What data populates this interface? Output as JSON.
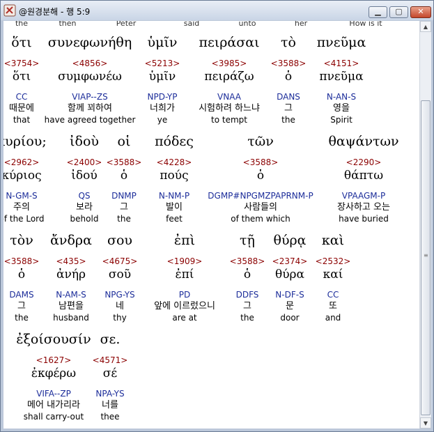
{
  "window": {
    "title": "@원경분해 - 행 5:9",
    "min_label": "▁",
    "max_label": "▢",
    "close_label": "✕"
  },
  "top_glosses": [
    "the",
    "then",
    "Peter",
    "said",
    "unto",
    "her",
    "How is it"
  ],
  "rows": [
    [
      {
        "greek": "ὅτι",
        "strong": "<3754>",
        "lemma": "ὅτι",
        "parse": "CC",
        "korean": "때문에",
        "english": "that"
      },
      {
        "greek": "συνεφωνήθη",
        "strong": "<4856>",
        "lemma": "συμφωνέω",
        "parse": "VIAP--ZS",
        "korean": "함께 꾀하여",
        "english": "have agreed together"
      },
      {
        "greek": "ὑμῖν",
        "strong": "<5213>",
        "lemma": "ὑμῖν",
        "parse": "NPD-YP",
        "korean": "너희가",
        "english": "ye"
      },
      {
        "greek": "πειράσαι",
        "strong": "<3985>",
        "lemma": "πειράζω",
        "parse": "VNAA",
        "korean": "시험하려 하느냐",
        "english": "to tempt"
      },
      {
        "greek": "τὸ",
        "strong": "<3588>",
        "lemma": "ὁ",
        "parse": "DANS",
        "korean": "그",
        "english": "the"
      },
      {
        "greek": "πνεῦμα",
        "strong": "<4151>",
        "lemma": "πνεῦμα",
        "parse": "N-AN-S",
        "korean": "영을",
        "english": "Spirit"
      }
    ],
    [
      {
        "greek": "κυρίου;",
        "strong": "<2962>",
        "lemma": "κύριος",
        "parse": "N-GM-S",
        "korean": "주의",
        "english": "of the Lord"
      },
      {
        "greek": "ἰδοὺ",
        "strong": "<2400>",
        "lemma": "ἰδού",
        "parse": "QS",
        "korean": "보라",
        "english": "behold"
      },
      {
        "greek": "οἱ",
        "strong": "<3588>",
        "lemma": "ὁ",
        "parse": "DNMP",
        "korean": "그",
        "english": "the"
      },
      {
        "greek": "πόδες",
        "strong": "<4228>",
        "lemma": "πούς",
        "parse": "N-NM-P",
        "korean": "발이",
        "english": "feet"
      },
      {
        "greek": "τῶν",
        "strong": "<3588>",
        "lemma": "ὁ",
        "parse": "DGMP#NPGMZPAPRNM-P",
        "korean": "사람들의",
        "english": "of them which"
      },
      {
        "greek": "θαψάντων",
        "strong": "<2290>",
        "lemma": "θάπτω",
        "parse": "VPAAGM-P",
        "korean": "장사하고 오는",
        "english": "have buried"
      }
    ],
    [
      {
        "greek": "τὸν",
        "strong": "<3588>",
        "lemma": "ὁ",
        "parse": "DAMS",
        "korean": "그",
        "english": "the"
      },
      {
        "greek": "ἄνδρα",
        "strong": "<435>",
        "lemma": "ἀνήρ",
        "parse": "N-AM-S",
        "korean": "남편을",
        "english": "husband"
      },
      {
        "greek": "σου",
        "strong": "<4675>",
        "lemma": "σοῦ",
        "parse": "NPG-YS",
        "korean": "네",
        "english": "thy"
      },
      {
        "greek": "ἐπὶ",
        "strong": "<1909>",
        "lemma": "ἐπί",
        "parse": "PD",
        "korean": "앞에 이르렀으니",
        "english": "are at"
      },
      {
        "greek": "τῇ",
        "strong": "<3588>",
        "lemma": "ὁ",
        "parse": "DDFS",
        "korean": "그",
        "english": "the"
      },
      {
        "greek": "θύρᾳ",
        "strong": "<2374>",
        "lemma": "θύρα",
        "parse": "N-DF-S",
        "korean": "문",
        "english": "door"
      },
      {
        "greek": "καὶ",
        "strong": "<2532>",
        "lemma": "καί",
        "parse": "CC",
        "korean": "또",
        "english": "and"
      }
    ],
    [
      {
        "greek": "ἐξοίσουσίν",
        "strong": "<1627>",
        "lemma": "ἐκφέρω",
        "parse": "VIFA--ZP",
        "korean": "메어 내가리라",
        "english": "shall carry-out"
      },
      {
        "greek": "σε.",
        "strong": "<4571>",
        "lemma": "σέ",
        "parse": "NPA-YS",
        "korean": "너를",
        "english": "thee"
      }
    ]
  ],
  "icons": {
    "app": "scroll-app-icon",
    "scroll_up": "chevron-up-icon",
    "scroll_down": "chevron-down-icon"
  }
}
